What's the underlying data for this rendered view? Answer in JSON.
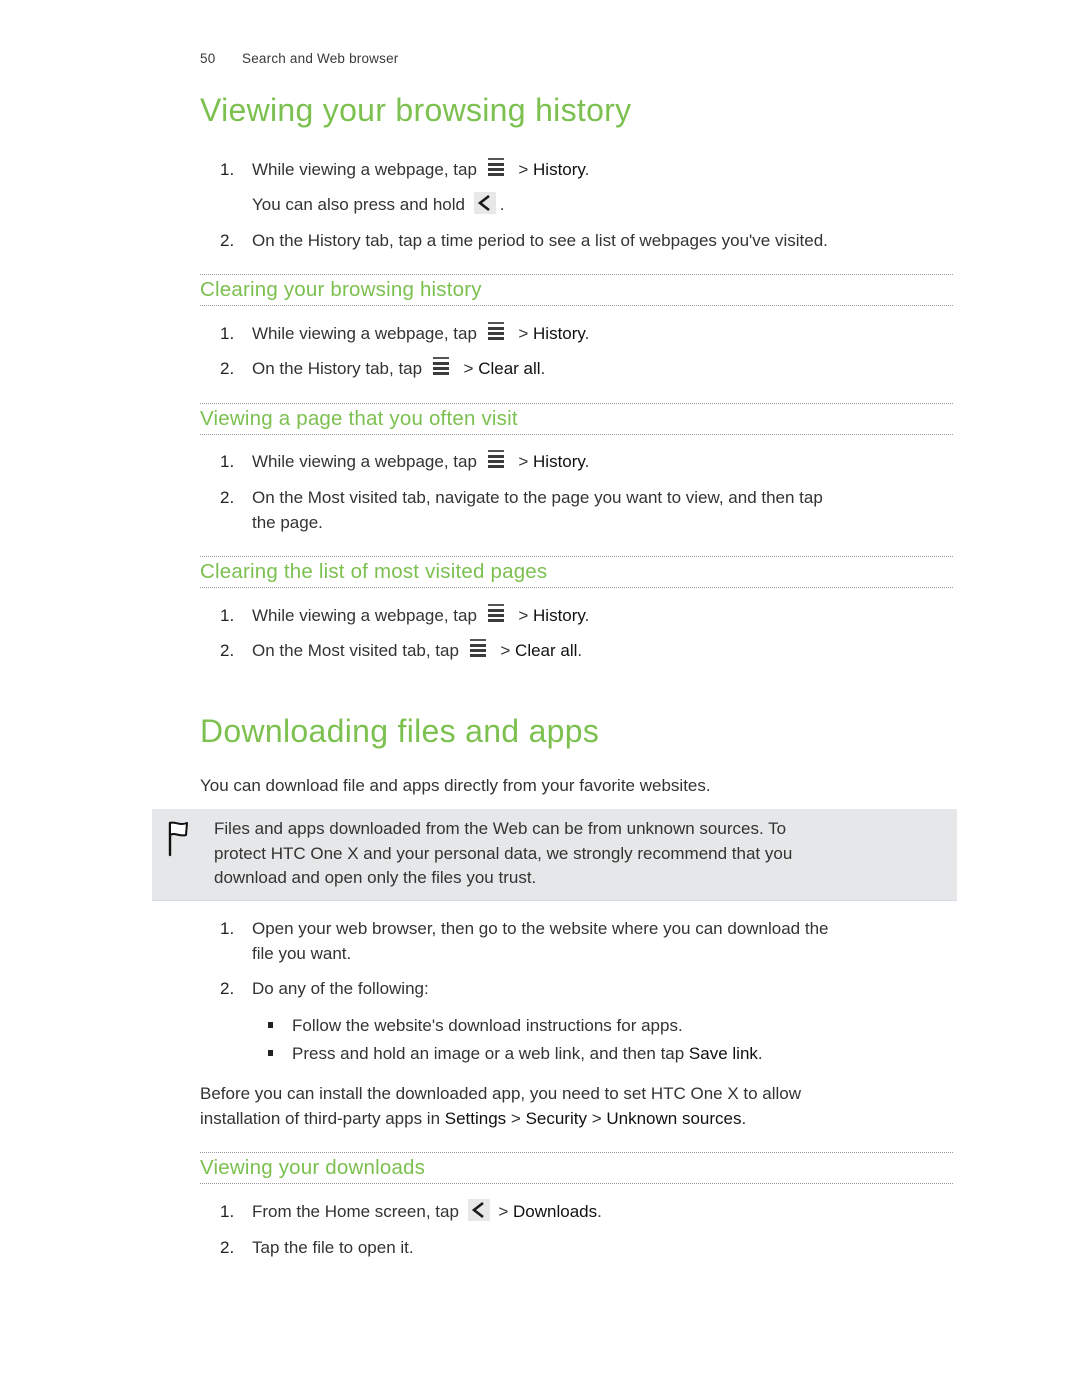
{
  "header": {
    "page_number": "50",
    "section": "Search and Web browser"
  },
  "sections": {
    "viewing_history": {
      "title": "Viewing your browsing history",
      "steps": [
        {
          "num": "1.",
          "before": "While viewing a webpage, tap",
          "icon": "menu-icon",
          "after_sep": " > ",
          "term": "History",
          "end": "."
        },
        {
          "cont_before": "You can also press and hold",
          "icon": "back-icon",
          "cont_end": "."
        },
        {
          "num": "2.",
          "text": "On the History tab, tap a time period to see a list of webpages you've visited."
        }
      ]
    },
    "clearing_history": {
      "title": "Clearing your browsing history",
      "steps": [
        {
          "num": "1.",
          "before": "While viewing a webpage, tap",
          "icon": "menu-icon",
          "after_sep": " > ",
          "term": "History",
          "end": "."
        },
        {
          "num": "2.",
          "before": "On the History tab, tap",
          "icon": "menu-icon",
          "after_sep": " > ",
          "term": "Clear all",
          "end": "."
        }
      ]
    },
    "often_visit": {
      "title": "Viewing a page that you often visit",
      "steps": [
        {
          "num": "1.",
          "before": "While viewing a webpage, tap",
          "icon": "menu-icon",
          "after_sep": " > ",
          "term": "History",
          "end": "."
        },
        {
          "num": "2.",
          "line1": "On the Most visited tab, navigate to the page you want to view, and then tap",
          "line2": "the page."
        }
      ]
    },
    "clearing_most_visited": {
      "title": "Clearing the list of most visited pages",
      "steps": [
        {
          "num": "1.",
          "before": "While viewing a webpage, tap",
          "icon": "menu-icon",
          "after_sep": " > ",
          "term": "History",
          "end": "."
        },
        {
          "num": "2.",
          "before": "On the Most visited tab, tap",
          "icon": "menu-icon",
          "after_sep": " > ",
          "term": "Clear all",
          "end": "."
        }
      ]
    },
    "downloading": {
      "title": "Downloading files and apps",
      "intro": "You can download file and apps directly from your favorite websites.",
      "note": {
        "icon": "flag-icon",
        "lines": [
          "Files and apps downloaded from the Web can be from unknown sources. To",
          "protect HTC One X and your personal data, we strongly recommend that you",
          "download and open only the files you trust."
        ]
      },
      "steps": [
        {
          "num": "1.",
          "line1": "Open your web browser, then go to the website where you can download the",
          "line2": "file you want."
        },
        {
          "num": "2.",
          "text": "Do any of the following:"
        }
      ],
      "bullets": [
        {
          "text": "Follow the website's download instructions for apps."
        },
        {
          "before": "Press and hold an image or a web link, and then tap ",
          "term": "Save link",
          "end": "."
        }
      ],
      "install_note": {
        "line1": "Before you can install the downloaded app, you need to set HTC One X to allow",
        "line2_before": "installation of third-party apps in ",
        "term1": "Settings",
        "sep1": " > ",
        "term2": "Security",
        "sep2": " > ",
        "term3": "Unknown sources",
        "end": "."
      }
    },
    "viewing_downloads": {
      "title": "Viewing your downloads",
      "steps": [
        {
          "num": "1.",
          "before": "From the Home screen, tap",
          "icon": "back-icon",
          "after_sep": " > ",
          "term": "Downloads",
          "end": "."
        },
        {
          "num": "2.",
          "text": "Tap the file to open it."
        }
      ]
    }
  },
  "colors": {
    "heading_green": "#7cc04f",
    "note_background": "#e6e7e8",
    "body_text": "#333333"
  }
}
